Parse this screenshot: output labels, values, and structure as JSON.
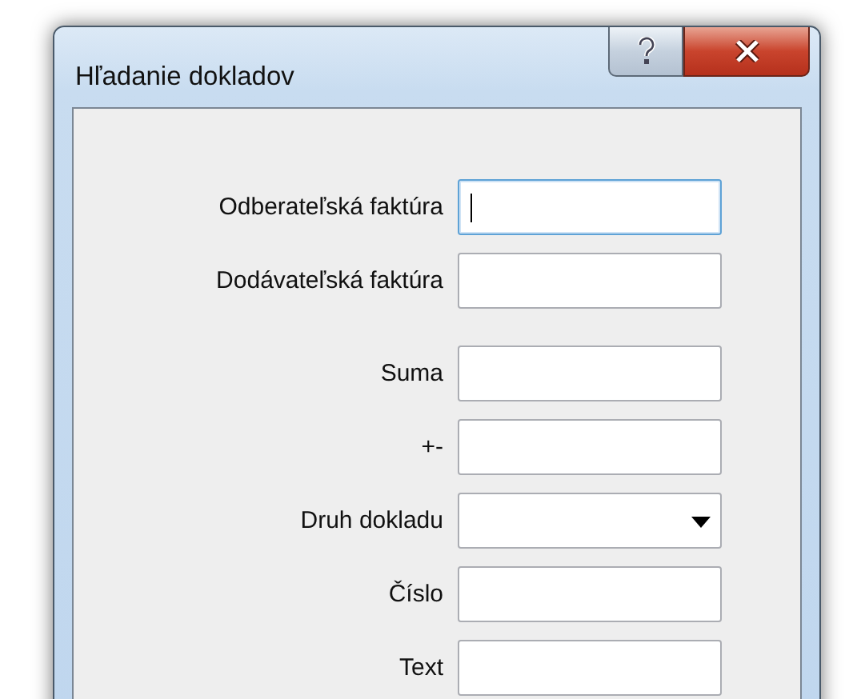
{
  "window": {
    "title": "Hľadanie dokladov"
  },
  "groups": [
    {
      "fields": [
        {
          "label": "Odberateľská faktúra",
          "kind": "text",
          "focused": true
        },
        {
          "label": "Dodávateľská faktúra",
          "kind": "text",
          "focused": false
        }
      ]
    },
    {
      "fields": [
        {
          "label": "Suma",
          "kind": "text",
          "focused": false
        },
        {
          "label": "+-",
          "kind": "text",
          "focused": false
        },
        {
          "label": "Druh dokladu",
          "kind": "dropdown",
          "focused": false
        },
        {
          "label": "Číslo",
          "kind": "text",
          "focused": false
        },
        {
          "label": "Text",
          "kind": "text",
          "focused": false
        }
      ]
    }
  ]
}
